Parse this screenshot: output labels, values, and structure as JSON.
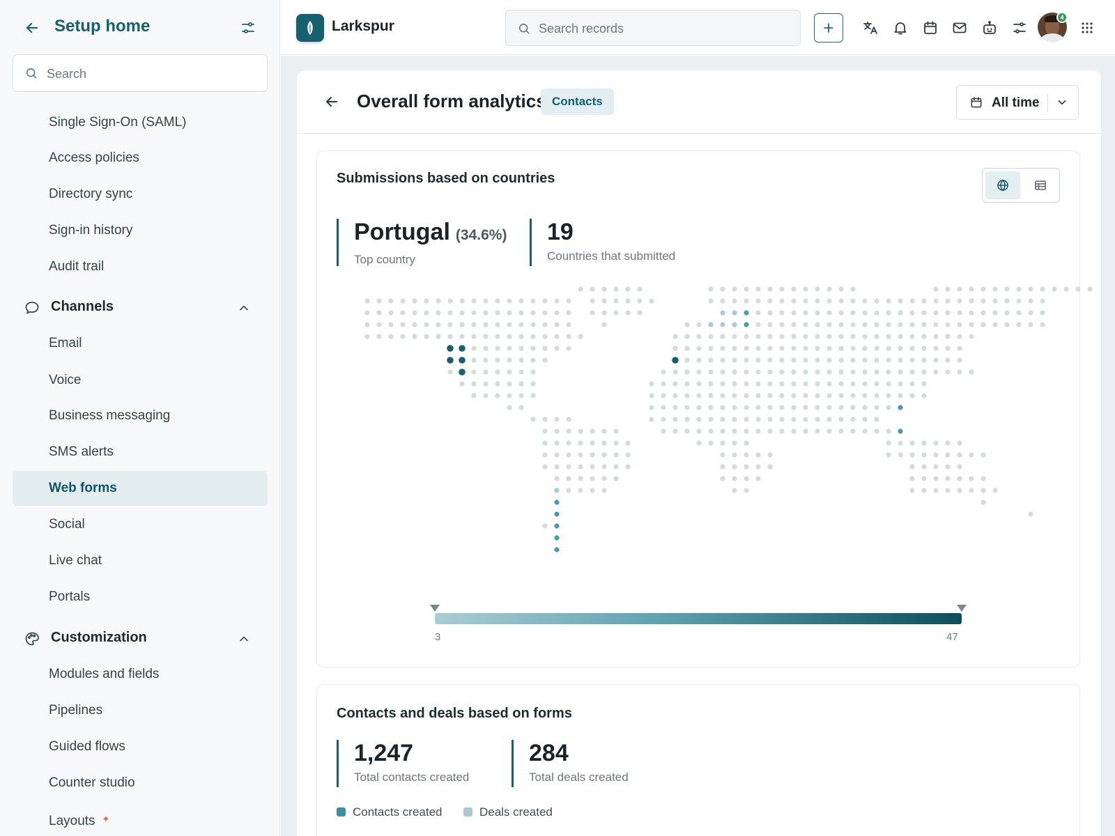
{
  "sidebar": {
    "title": "Setup home",
    "search_placeholder": "Search",
    "items_top": [
      {
        "label": "Single Sign-On (SAML)"
      },
      {
        "label": "Access policies"
      },
      {
        "label": "Directory sync"
      },
      {
        "label": "Sign-in history"
      },
      {
        "label": "Audit trail"
      }
    ],
    "channels": {
      "label": "Channels",
      "items": [
        {
          "label": "Email"
        },
        {
          "label": "Voice"
        },
        {
          "label": "Business messaging"
        },
        {
          "label": "SMS alerts"
        },
        {
          "label": "Web forms",
          "active": true
        },
        {
          "label": "Social"
        },
        {
          "label": "Live chat"
        },
        {
          "label": "Portals"
        }
      ]
    },
    "customization": {
      "label": "Customization",
      "items": [
        {
          "label": "Modules and fields"
        },
        {
          "label": "Pipelines"
        },
        {
          "label": "Guided flows"
        },
        {
          "label": "Counter studio"
        },
        {
          "label": "Layouts",
          "badge_icon": "sparkle-icon"
        }
      ]
    }
  },
  "topbar": {
    "brand": "Larkspur",
    "search_placeholder": "Search records",
    "notification_count": "4",
    "icons": [
      "add-icon",
      "translate-icon",
      "bell-icon",
      "calendar-icon",
      "mail-icon",
      "bot-icon",
      "sliders-icon",
      "avatar",
      "apps-grid-icon"
    ]
  },
  "header": {
    "title": "Overall form analytics",
    "chip": "Contacts",
    "time_filter": "All time"
  },
  "countries_panel": {
    "title": "Submissions based on countries",
    "top_country": "Portugal",
    "top_country_pct": "(34.6%)",
    "top_country_label": "Top country",
    "countries_count": "19",
    "countries_label": "Countries that submitted",
    "scale_min": "3",
    "scale_max": "47",
    "view_toggle": {
      "selected": "map",
      "options": [
        "map",
        "table"
      ]
    }
  },
  "forms_panel": {
    "title": "Contacts and deals based on forms",
    "contacts_total": "1,247",
    "contacts_label": "Total contacts created",
    "deals_total": "284",
    "deals_label": "Total deals created",
    "legend": [
      {
        "label": "Contacts created",
        "color": "#3d8fa0"
      },
      {
        "label": "Deals created",
        "color": "#a8c9d0"
      }
    ]
  },
  "colors": {
    "accent": "#17606f",
    "map_dot": "#d5dadd",
    "map_low": "#a6ccd3",
    "map_mid": "#4a9aaa",
    "map_high": "#17606f"
  }
}
